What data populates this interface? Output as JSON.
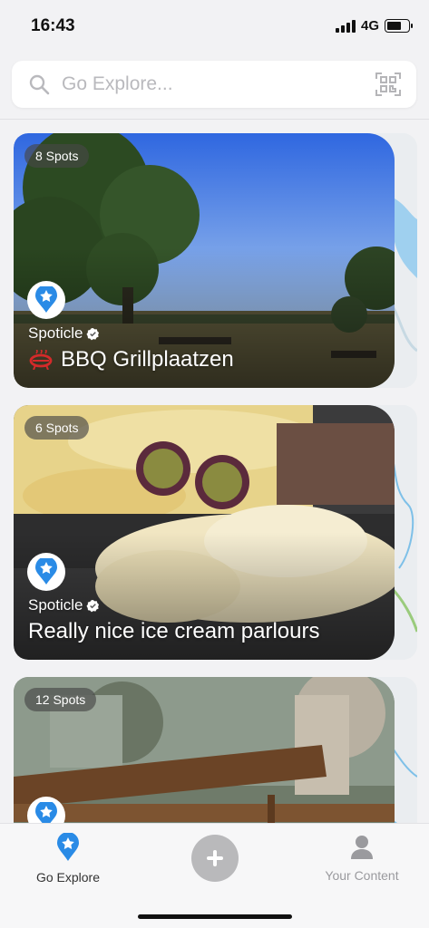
{
  "status": {
    "time": "16:43",
    "network": "4G"
  },
  "search": {
    "placeholder": "Go Explore...",
    "icon": "search-icon",
    "scan_icon": "qr-scan-icon"
  },
  "cards": [
    {
      "spots": "8 Spots",
      "author": "Spoticle",
      "title": "BBQ Grillplaatzen",
      "title_icon": "bbq-grill-icon"
    },
    {
      "spots": "6 Spots",
      "author": "Spoticle",
      "title": "Really nice ice cream parlours"
    },
    {
      "spots": "12 Spots",
      "author": "",
      "title": ""
    }
  ],
  "tabs": {
    "explore_label": "Go Explore",
    "add_icon": "plus-icon",
    "content_label": "Your Content"
  },
  "colors": {
    "accent": "#2a8be6",
    "grill_red": "#d42a2a",
    "tab_inactive": "#9a9a9e"
  }
}
